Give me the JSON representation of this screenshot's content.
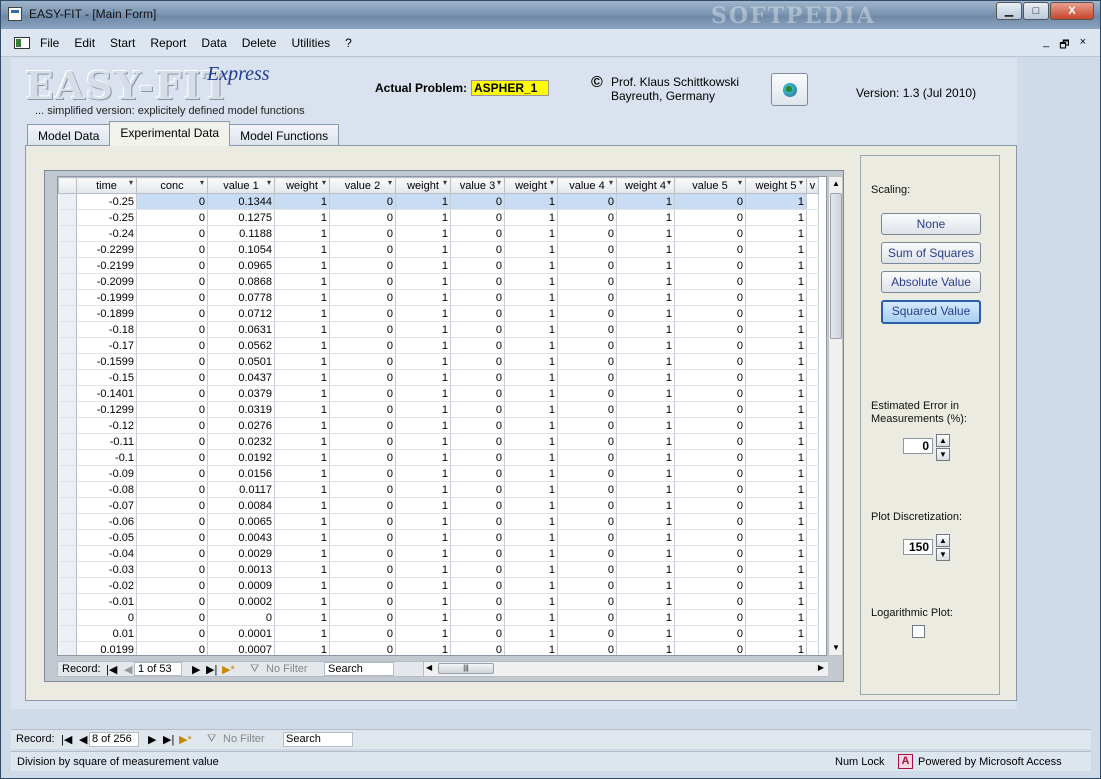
{
  "window": {
    "title": "EASY-FIT - [Main Form]",
    "watermark": "SOFTPEDIA",
    "btn_min": "▁",
    "btn_max": "□",
    "btn_close": "X"
  },
  "menu": {
    "items": [
      "File",
      "Edit",
      "Start",
      "Report",
      "Data",
      "Delete",
      "Utilities",
      "?"
    ],
    "mdi_min": "_",
    "mdi_restore": "🗗",
    "mdi_close": "×"
  },
  "header": {
    "logo": "EASY-FIT",
    "express": "Express",
    "subtitle": "... simplified version: explicitely defined model functions",
    "actual_problem_label": "Actual Problem:",
    "actual_problem_value": "ASPHER_1",
    "copyright_symbol": "©",
    "author_line1": "Prof. Klaus Schittkowski",
    "author_line2": "Bayreuth, Germany",
    "version": "Version:  1.3 (Jul 2010)"
  },
  "tabs": [
    "Model Data",
    "Experimental Data",
    "Model Functions"
  ],
  "grid": {
    "columns": [
      "time",
      "conc",
      "value 1",
      "weight",
      "value 2",
      "weight",
      "value 3",
      "weight",
      "value 4",
      "weight 4",
      "value 5",
      "weight 5",
      "v"
    ],
    "rows": [
      [
        "-0.25",
        "0",
        "0.1344",
        "1",
        "0",
        "1",
        "0",
        "1",
        "0",
        "1",
        "0",
        "1"
      ],
      [
        "-0.25",
        "0",
        "0.1275",
        "1",
        "0",
        "1",
        "0",
        "1",
        "0",
        "1",
        "0",
        "1"
      ],
      [
        "-0.24",
        "0",
        "0.1188",
        "1",
        "0",
        "1",
        "0",
        "1",
        "0",
        "1",
        "0",
        "1"
      ],
      [
        "-0.2299",
        "0",
        "0.1054",
        "1",
        "0",
        "1",
        "0",
        "1",
        "0",
        "1",
        "0",
        "1"
      ],
      [
        "-0.2199",
        "0",
        "0.0965",
        "1",
        "0",
        "1",
        "0",
        "1",
        "0",
        "1",
        "0",
        "1"
      ],
      [
        "-0.2099",
        "0",
        "0.0868",
        "1",
        "0",
        "1",
        "0",
        "1",
        "0",
        "1",
        "0",
        "1"
      ],
      [
        "-0.1999",
        "0",
        "0.0778",
        "1",
        "0",
        "1",
        "0",
        "1",
        "0",
        "1",
        "0",
        "1"
      ],
      [
        "-0.1899",
        "0",
        "0.0712",
        "1",
        "0",
        "1",
        "0",
        "1",
        "0",
        "1",
        "0",
        "1"
      ],
      [
        "-0.18",
        "0",
        "0.0631",
        "1",
        "0",
        "1",
        "0",
        "1",
        "0",
        "1",
        "0",
        "1"
      ],
      [
        "-0.17",
        "0",
        "0.0562",
        "1",
        "0",
        "1",
        "0",
        "1",
        "0",
        "1",
        "0",
        "1"
      ],
      [
        "-0.1599",
        "0",
        "0.0501",
        "1",
        "0",
        "1",
        "0",
        "1",
        "0",
        "1",
        "0",
        "1"
      ],
      [
        "-0.15",
        "0",
        "0.0437",
        "1",
        "0",
        "1",
        "0",
        "1",
        "0",
        "1",
        "0",
        "1"
      ],
      [
        "-0.1401",
        "0",
        "0.0379",
        "1",
        "0",
        "1",
        "0",
        "1",
        "0",
        "1",
        "0",
        "1"
      ],
      [
        "-0.1299",
        "0",
        "0.0319",
        "1",
        "0",
        "1",
        "0",
        "1",
        "0",
        "1",
        "0",
        "1"
      ],
      [
        "-0.12",
        "0",
        "0.0276",
        "1",
        "0",
        "1",
        "0",
        "1",
        "0",
        "1",
        "0",
        "1"
      ],
      [
        "-0.11",
        "0",
        "0.0232",
        "1",
        "0",
        "1",
        "0",
        "1",
        "0",
        "1",
        "0",
        "1"
      ],
      [
        "-0.1",
        "0",
        "0.0192",
        "1",
        "0",
        "1",
        "0",
        "1",
        "0",
        "1",
        "0",
        "1"
      ],
      [
        "-0.09",
        "0",
        "0.0156",
        "1",
        "0",
        "1",
        "0",
        "1",
        "0",
        "1",
        "0",
        "1"
      ],
      [
        "-0.08",
        "0",
        "0.0117",
        "1",
        "0",
        "1",
        "0",
        "1",
        "0",
        "1",
        "0",
        "1"
      ],
      [
        "-0.07",
        "0",
        "0.0084",
        "1",
        "0",
        "1",
        "0",
        "1",
        "0",
        "1",
        "0",
        "1"
      ],
      [
        "-0.06",
        "0",
        "0.0065",
        "1",
        "0",
        "1",
        "0",
        "1",
        "0",
        "1",
        "0",
        "1"
      ],
      [
        "-0.05",
        "0",
        "0.0043",
        "1",
        "0",
        "1",
        "0",
        "1",
        "0",
        "1",
        "0",
        "1"
      ],
      [
        "-0.04",
        "0",
        "0.0029",
        "1",
        "0",
        "1",
        "0",
        "1",
        "0",
        "1",
        "0",
        "1"
      ],
      [
        "-0.03",
        "0",
        "0.0013",
        "1",
        "0",
        "1",
        "0",
        "1",
        "0",
        "1",
        "0",
        "1"
      ],
      [
        "-0.02",
        "0",
        "0.0009",
        "1",
        "0",
        "1",
        "0",
        "1",
        "0",
        "1",
        "0",
        "1"
      ],
      [
        "-0.01",
        "0",
        "0.0002",
        "1",
        "0",
        "1",
        "0",
        "1",
        "0",
        "1",
        "0",
        "1"
      ],
      [
        "0",
        "0",
        "0",
        "1",
        "0",
        "1",
        "0",
        "1",
        "0",
        "1",
        "0",
        "1"
      ],
      [
        "0.01",
        "0",
        "0.0001",
        "1",
        "0",
        "1",
        "0",
        "1",
        "0",
        "1",
        "0",
        "1"
      ],
      [
        "0.0199",
        "0",
        "0.0007",
        "1",
        "0",
        "1",
        "0",
        "1",
        "0",
        "1",
        "0",
        "1"
      ]
    ],
    "nav": {
      "label": "Record:",
      "position": "1 of 53",
      "filter": "No Filter",
      "search": "Search"
    }
  },
  "scaling": {
    "label": "Scaling:",
    "options": [
      "None",
      "Sum of Squares",
      "Absolute Value",
      "Squared Value"
    ],
    "selected": "Squared Value"
  },
  "error": {
    "label1": "Estimated Error in",
    "label2": "Measurements (%):",
    "value": "0"
  },
  "plot": {
    "label": "Plot Discretization:",
    "value": "150"
  },
  "logplot": {
    "label": "Logarithmic Plot:",
    "checked": false
  },
  "form_nav": {
    "label": "Record:",
    "position": "8 of 256",
    "filter": "No Filter",
    "search": "Search"
  },
  "status": {
    "text": "Division by square of measurement value",
    "numlock": "Num Lock",
    "access_icon": "A",
    "powered": "Powered by Microsoft Access"
  }
}
